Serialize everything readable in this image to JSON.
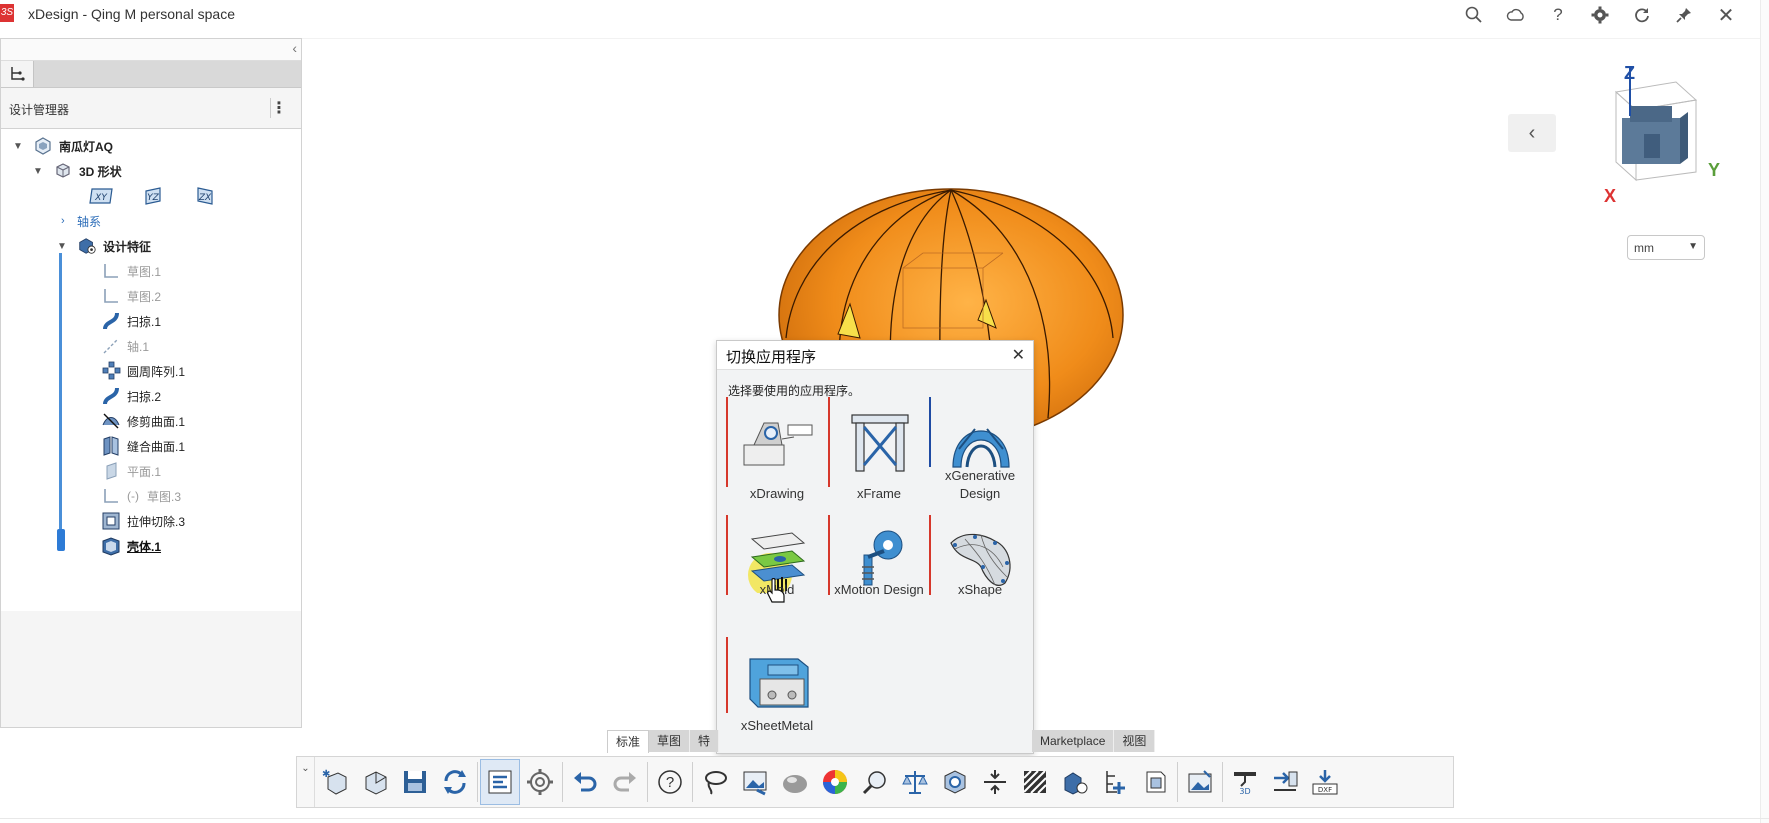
{
  "window": {
    "title": "xDesign - Qing M personal space"
  },
  "top_icons": [
    "search-icon",
    "cloud-icon",
    "help-icon",
    "gear-icon",
    "refresh-icon",
    "pin-icon",
    "close-icon"
  ],
  "manager": {
    "title": "设计管理器"
  },
  "tree": {
    "root": "南瓜灯AQ",
    "shape": "3D 形状",
    "planes": [
      "XY",
      "YZ",
      "ZX"
    ],
    "axes": "轴系",
    "features_group": "设计特征",
    "features": [
      {
        "label": "草图.1",
        "suppressed": true,
        "icon": "sketch-icon"
      },
      {
        "label": "草图.2",
        "suppressed": true,
        "icon": "sketch-icon"
      },
      {
        "label": "扫掠.1",
        "suppressed": false,
        "icon": "sweep-icon"
      },
      {
        "label": "轴.1",
        "suppressed": true,
        "icon": "axis-icon"
      },
      {
        "label": "圆周阵列.1",
        "suppressed": false,
        "icon": "circular-pattern-icon"
      },
      {
        "label": "扫掠.2",
        "suppressed": false,
        "icon": "sweep-icon"
      },
      {
        "label": "修剪曲面.1",
        "suppressed": false,
        "icon": "trim-surface-icon"
      },
      {
        "label": "缝合曲面.1",
        "suppressed": false,
        "icon": "knit-surface-icon"
      },
      {
        "label": "平面.1",
        "suppressed": true,
        "icon": "plane-icon"
      },
      {
        "label": "草图.3",
        "prefix": "(-)",
        "suppressed": true,
        "icon": "sketch-icon"
      },
      {
        "label": "拉伸切除.3",
        "suppressed": false,
        "icon": "extrude-cut-icon"
      },
      {
        "label": "壳体.1",
        "suppressed": false,
        "icon": "shell-icon"
      }
    ]
  },
  "viewcube": {
    "axes": [
      "Z",
      "Y",
      "X"
    ]
  },
  "units": {
    "selected": "mm"
  },
  "dialog": {
    "title": "切换应用程序",
    "subtitle": "选择要使用的应用程序。",
    "apps": [
      {
        "name": "xDrawing"
      },
      {
        "name": "xFrame"
      },
      {
        "name": "xGenerative Design",
        "line1": "xGenerative",
        "line2": "Design"
      },
      {
        "name": "xMold"
      },
      {
        "name": "xMotion Design"
      },
      {
        "name": "xShape"
      },
      {
        "name": "xSheetMetal"
      }
    ]
  },
  "toolbar_tabs": [
    "标准",
    "草图",
    "特"
  ],
  "toolbar_tabs_right": [
    "Marketplace",
    "视图"
  ],
  "colors": {
    "accent": "#2d7bd6",
    "app_bar_red": "#d6372b",
    "app_bar_blue": "#1f4ba3",
    "pumpkin": "#f08c1a"
  }
}
